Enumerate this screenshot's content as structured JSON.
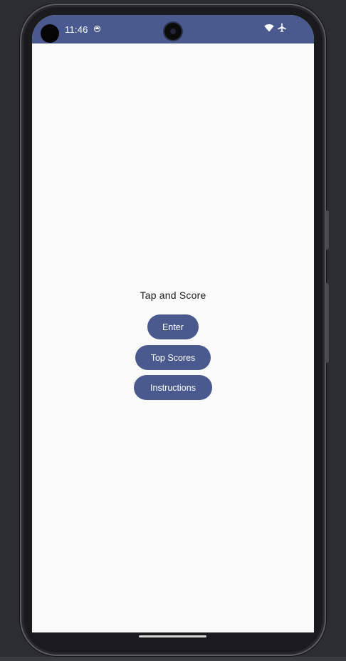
{
  "status_bar": {
    "time": "11:46",
    "background_color": "#4a5a8e",
    "icons": [
      "app-notification-icon",
      "wifi-icon",
      "airplane-mode-icon"
    ]
  },
  "app": {
    "title": "Tap and Score",
    "accent_color": "#4a5a8e",
    "buttons": {
      "enter": "Enter",
      "top_scores": "Top Scores",
      "instructions": "Instructions"
    }
  }
}
